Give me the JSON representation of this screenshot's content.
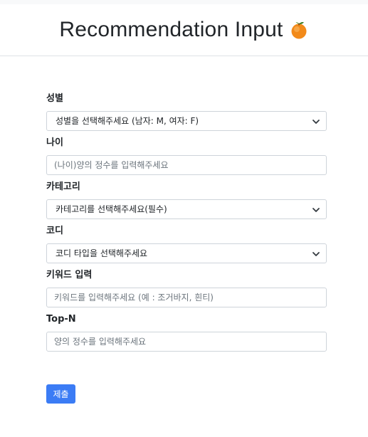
{
  "header": {
    "title": "Recommendation Input",
    "icon": "orange-emoji-icon"
  },
  "form": {
    "gender": {
      "label": "성별",
      "selected": "성별을 선택해주세요 (남자: M, 여자: F)"
    },
    "age": {
      "label": "나이",
      "placeholder": "(나이)양의 정수를 입력해주세요"
    },
    "category": {
      "label": "카테고리",
      "selected": "카테고리를 선택해주세요(필수)"
    },
    "coordi": {
      "label": "코디",
      "selected": "코디 타입을 선택해주세요"
    },
    "keyword": {
      "label": "키워드 입력",
      "placeholder": "키워드를 입력해주세요 (예 : 조거바지, 흰티)"
    },
    "topn": {
      "label": "Top-N",
      "placeholder": "양의 정수를 입력해주세요"
    },
    "submit_label": "제출"
  },
  "colors": {
    "submit_bg": "#3b7cf5",
    "border": "#ced4da",
    "label": "#212529"
  }
}
